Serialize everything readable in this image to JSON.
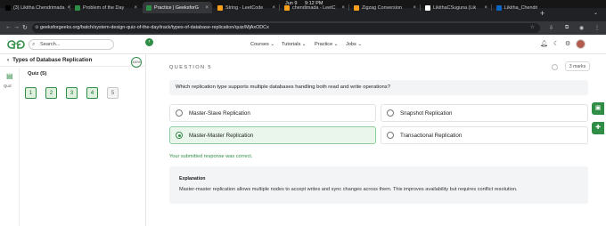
{
  "system_bar": {
    "date": "Jun 9",
    "time": "9:12 PM"
  },
  "tabs": [
    {
      "label": "(3) Likitha Chendrimada",
      "icon": "x-logo-icon",
      "color": "#000000"
    },
    {
      "label": "Problem of the Day",
      "icon": "gfg-icon",
      "color": "#2f8d46"
    },
    {
      "label": "Practice | GeeksforG",
      "icon": "gfg-icon",
      "color": "#2f8d46",
      "active": true
    },
    {
      "label": "String - LeetCode",
      "icon": "leetcode-icon",
      "color": "#f89f1b"
    },
    {
      "label": "chendimada - LeetC",
      "icon": "leetcode-icon",
      "color": "#f89f1b"
    },
    {
      "label": "Zigzag Conversion",
      "icon": "leetcode-icon",
      "color": "#f89f1b"
    },
    {
      "label": "LikithaCSuguna (Lik",
      "icon": "github-icon",
      "color": "#ffffff"
    },
    {
      "label": "Likitha_Chendrimada",
      "icon": "linkedin-icon",
      "color": "#0a66c2"
    }
  ],
  "address_bar": {
    "url": "geeksforgeeks.org/batch/system-design-quiz-of-the-day/track/types-of-database-replication/quiz/MjAxODCx"
  },
  "header": {
    "search_placeholder": "Search...",
    "nav": [
      "Courses",
      "Tutorials",
      "Practice",
      "Jobs"
    ]
  },
  "left_panel": {
    "course_title": "Types of Database Replication",
    "progress": "100%",
    "rail_label": "Quiz",
    "quiz_title": "Quiz (5)",
    "questions": [
      {
        "num": "1",
        "state": "answered"
      },
      {
        "num": "2",
        "state": "answered"
      },
      {
        "num": "3",
        "state": "answered"
      },
      {
        "num": "4",
        "state": "answered"
      },
      {
        "num": "5",
        "state": "current"
      }
    ]
  },
  "question": {
    "label": "QUESTION 5",
    "marks": "3 marks",
    "text": "Which replication type supports multiple databases handling both read and write operations?",
    "options": [
      {
        "label": "Master-Slave Replication",
        "selected": false
      },
      {
        "label": "Snapshot Replication",
        "selected": false
      },
      {
        "label": "Master-Master Replication",
        "selected": true
      },
      {
        "label": "Transactional Replication",
        "selected": false
      }
    ],
    "status": "Your submitted response was correct.",
    "explanation_title": "Explanation",
    "explanation": "Master-master replication allows multiple nodes to accept writes and sync changes across them. This improves availability but requires conflict resolution."
  },
  "colors": {
    "accent": "#2f8d46",
    "correct_bg": "#eaf6ec"
  }
}
